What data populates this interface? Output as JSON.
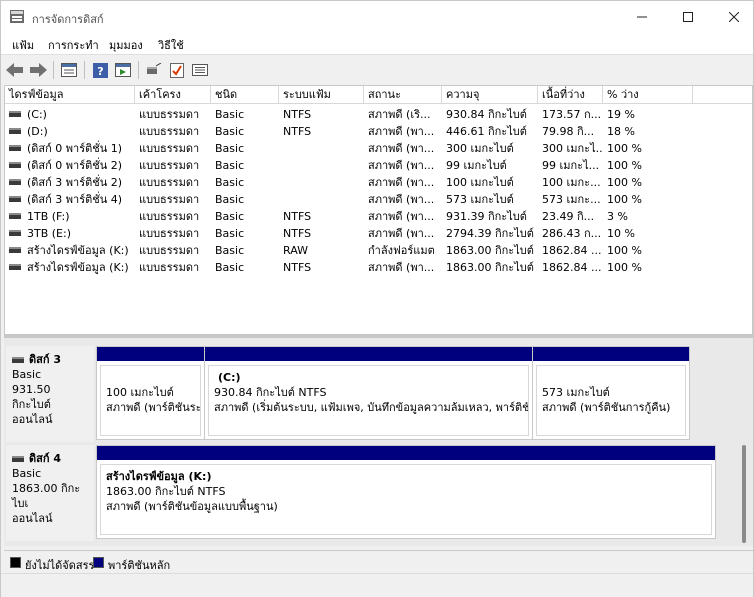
{
  "window": {
    "title": "การจัดการดิสก์"
  },
  "menu": {
    "items": [
      "แฟ้ม",
      "การกระทำ",
      "มุมมอง",
      "วิธีใช้"
    ]
  },
  "toolbar": {
    "icons": [
      "back-arrow-icon",
      "forward-arrow-icon",
      "properties-icon",
      "help-icon",
      "console-icon",
      "rescan-icon",
      "check-icon",
      "list-icon"
    ]
  },
  "list": {
    "headers": [
      "ไดรฟ์ข้อมูล",
      "เค้าโครง",
      "ชนิด",
      "ระบบแฟ้ม",
      "สถานะ",
      "ความจุ",
      "เนื้อที่ว่าง",
      "% ว่าง"
    ],
    "rows": [
      [
        "(C:)",
        "แบบธรรมดา",
        "Basic",
        "NTFS",
        "สภาพดี (เริ...",
        "930.84 กิกะไบต์",
        "173.57 ก...",
        "19 %"
      ],
      [
        "(D:)",
        "แบบธรรมดา",
        "Basic",
        "NTFS",
        "สภาพดี (พา...",
        "446.61 กิกะไบต์",
        "79.98 กิ...",
        "18 %"
      ],
      [
        "(ดิสก์ 0 พาร์ติชั่น 1)",
        "แบบธรรมดา",
        "Basic",
        "",
        "สภาพดี (พา...",
        "300 เมกะไบต์",
        "300 เมกะไ...",
        "100 %"
      ],
      [
        "(ดิสก์ 0 พาร์ติชั่น 2)",
        "แบบธรรมดา",
        "Basic",
        "",
        "สภาพดี (พา...",
        "99 เมกะไบต์",
        "99 เมกะไ...",
        "100 %"
      ],
      [
        "(ดิสก์ 3 พาร์ติชั่น 2)",
        "แบบธรรมดา",
        "Basic",
        "",
        "สภาพดี (พา...",
        "100 เมกะไบต์",
        "100 เมกะ...",
        "100 %"
      ],
      [
        "(ดิสก์ 3 พาร์ติชั่น 4)",
        "แบบธรรมดา",
        "Basic",
        "",
        "สภาพดี (พา...",
        "573 เมกะไบต์",
        "573 เมกะ...",
        "100 %"
      ],
      [
        "1TB (F:)",
        "แบบธรรมดา",
        "Basic",
        "NTFS",
        "สภาพดี (พา...",
        "931.39 กิกะไบต์",
        "23.49 กิ...",
        "3 %"
      ],
      [
        "3TB (E:)",
        "แบบธรรมดา",
        "Basic",
        "NTFS",
        "สภาพดี (พา...",
        "2794.39 กิกะไบต์",
        "286.43 ก...",
        "10 %"
      ],
      [
        "สร้างไดรฟ์ข้อมูล (K:)",
        "แบบธรรมดา",
        "Basic",
        "RAW",
        "กำลังฟอร์แมต",
        "1863.00 กิกะไบต์",
        "1862.84 ...",
        "100 %"
      ],
      [
        "สร้างไดรฟ์ข้อมูล (K:)",
        "แบบธรรมดา",
        "Basic",
        "NTFS",
        "สภาพดี (พา...",
        "1863.00 กิกะไบต์",
        "1862.84 ...",
        "100 %"
      ]
    ]
  },
  "disks": [
    {
      "name": "ดิสก์ 3",
      "type": "Basic",
      "size": "931.50 กิกะไบต์",
      "status": "ออนไลน์",
      "partitions": [
        {
          "title": "",
          "line1": "100 เมกะไบต์",
          "line2": "สภาพดี (พาร์ติชันระบ"
        },
        {
          "title": "(C:)",
          "line1": "930.84 กิกะไบต์ NTFS",
          "line2": "สภาพดี (เริ่มต้นระบบ, แฟ้มเพจ, บันทึกข้อมูลความล้มเหลว, พาร์ติชันข้อ"
        },
        {
          "title": "",
          "line1": "573 เมกะไบต์",
          "line2": "สภาพดี (พาร์ติชันการกู้คืน)"
        }
      ]
    },
    {
      "name": "ดิสก์ 4",
      "type": "Basic",
      "size": "1863.00 กิกะไบเ",
      "status": "ออนไลน์",
      "partitions": [
        {
          "title": "สร้างไดรฟ์ข้อมูล  (K:)",
          "line1": "1863.00 กิกะไบต์ NTFS",
          "line2": "สภาพดี (พาร์ติชันข้อมูลแบบพื้นฐาน)"
        }
      ]
    }
  ],
  "legend": [
    {
      "label": "ยังไม่ได้จัดสรร",
      "color": "#000000"
    },
    {
      "label": "พาร์ติชันหลัก",
      "color": "#00007f"
    }
  ]
}
